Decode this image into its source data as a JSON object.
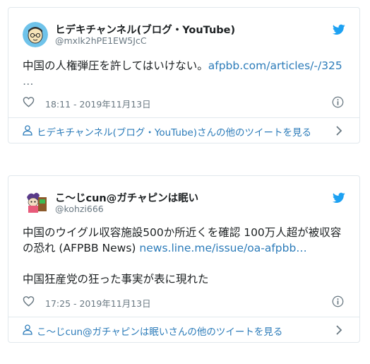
{
  "tweets": [
    {
      "name": "ヒデキチャンネル(ブログ・YouTube)",
      "handle": "@mxlk2hPE1EW5JcC",
      "text_line1": "中国の人権弾圧を許してはいけない。",
      "link_text": "afpbb.com/articles/-/325",
      "ellipsis": "…",
      "timestamp": "18:11 - 2019年11月13日",
      "more_label": "ヒデキチャンネル(ブログ・YouTube)さんの他のツイートを見る"
    },
    {
      "name": "こ～じcun@ガチャピンは眠い",
      "handle": "@kohzi666",
      "text_line1": "中国のウイグル収容施設500か所近くを確認 100万人超が被収容",
      "text_line2": "の恐れ (AFPBB News)",
      "link_text": "news.line.me/issue/oa-afpbb…",
      "text_line3": "中国狂産党の狂った事実が表に現れた",
      "timestamp": "17:25 - 2019年11月13日",
      "more_label": "こ～じcun@ガチャピンは眠いさんの他のツイートを見る"
    }
  ],
  "icons": {
    "twitter_bird": "twitter-bird-icon",
    "heart": "heart-icon",
    "info": "info-icon",
    "person": "person-icon",
    "chevron": "chevron-right-icon"
  },
  "colors": {
    "link": "#2b7bb9",
    "bird": "#1da1f2",
    "secondary_text": "#697882",
    "border": "#e1e8ed"
  }
}
